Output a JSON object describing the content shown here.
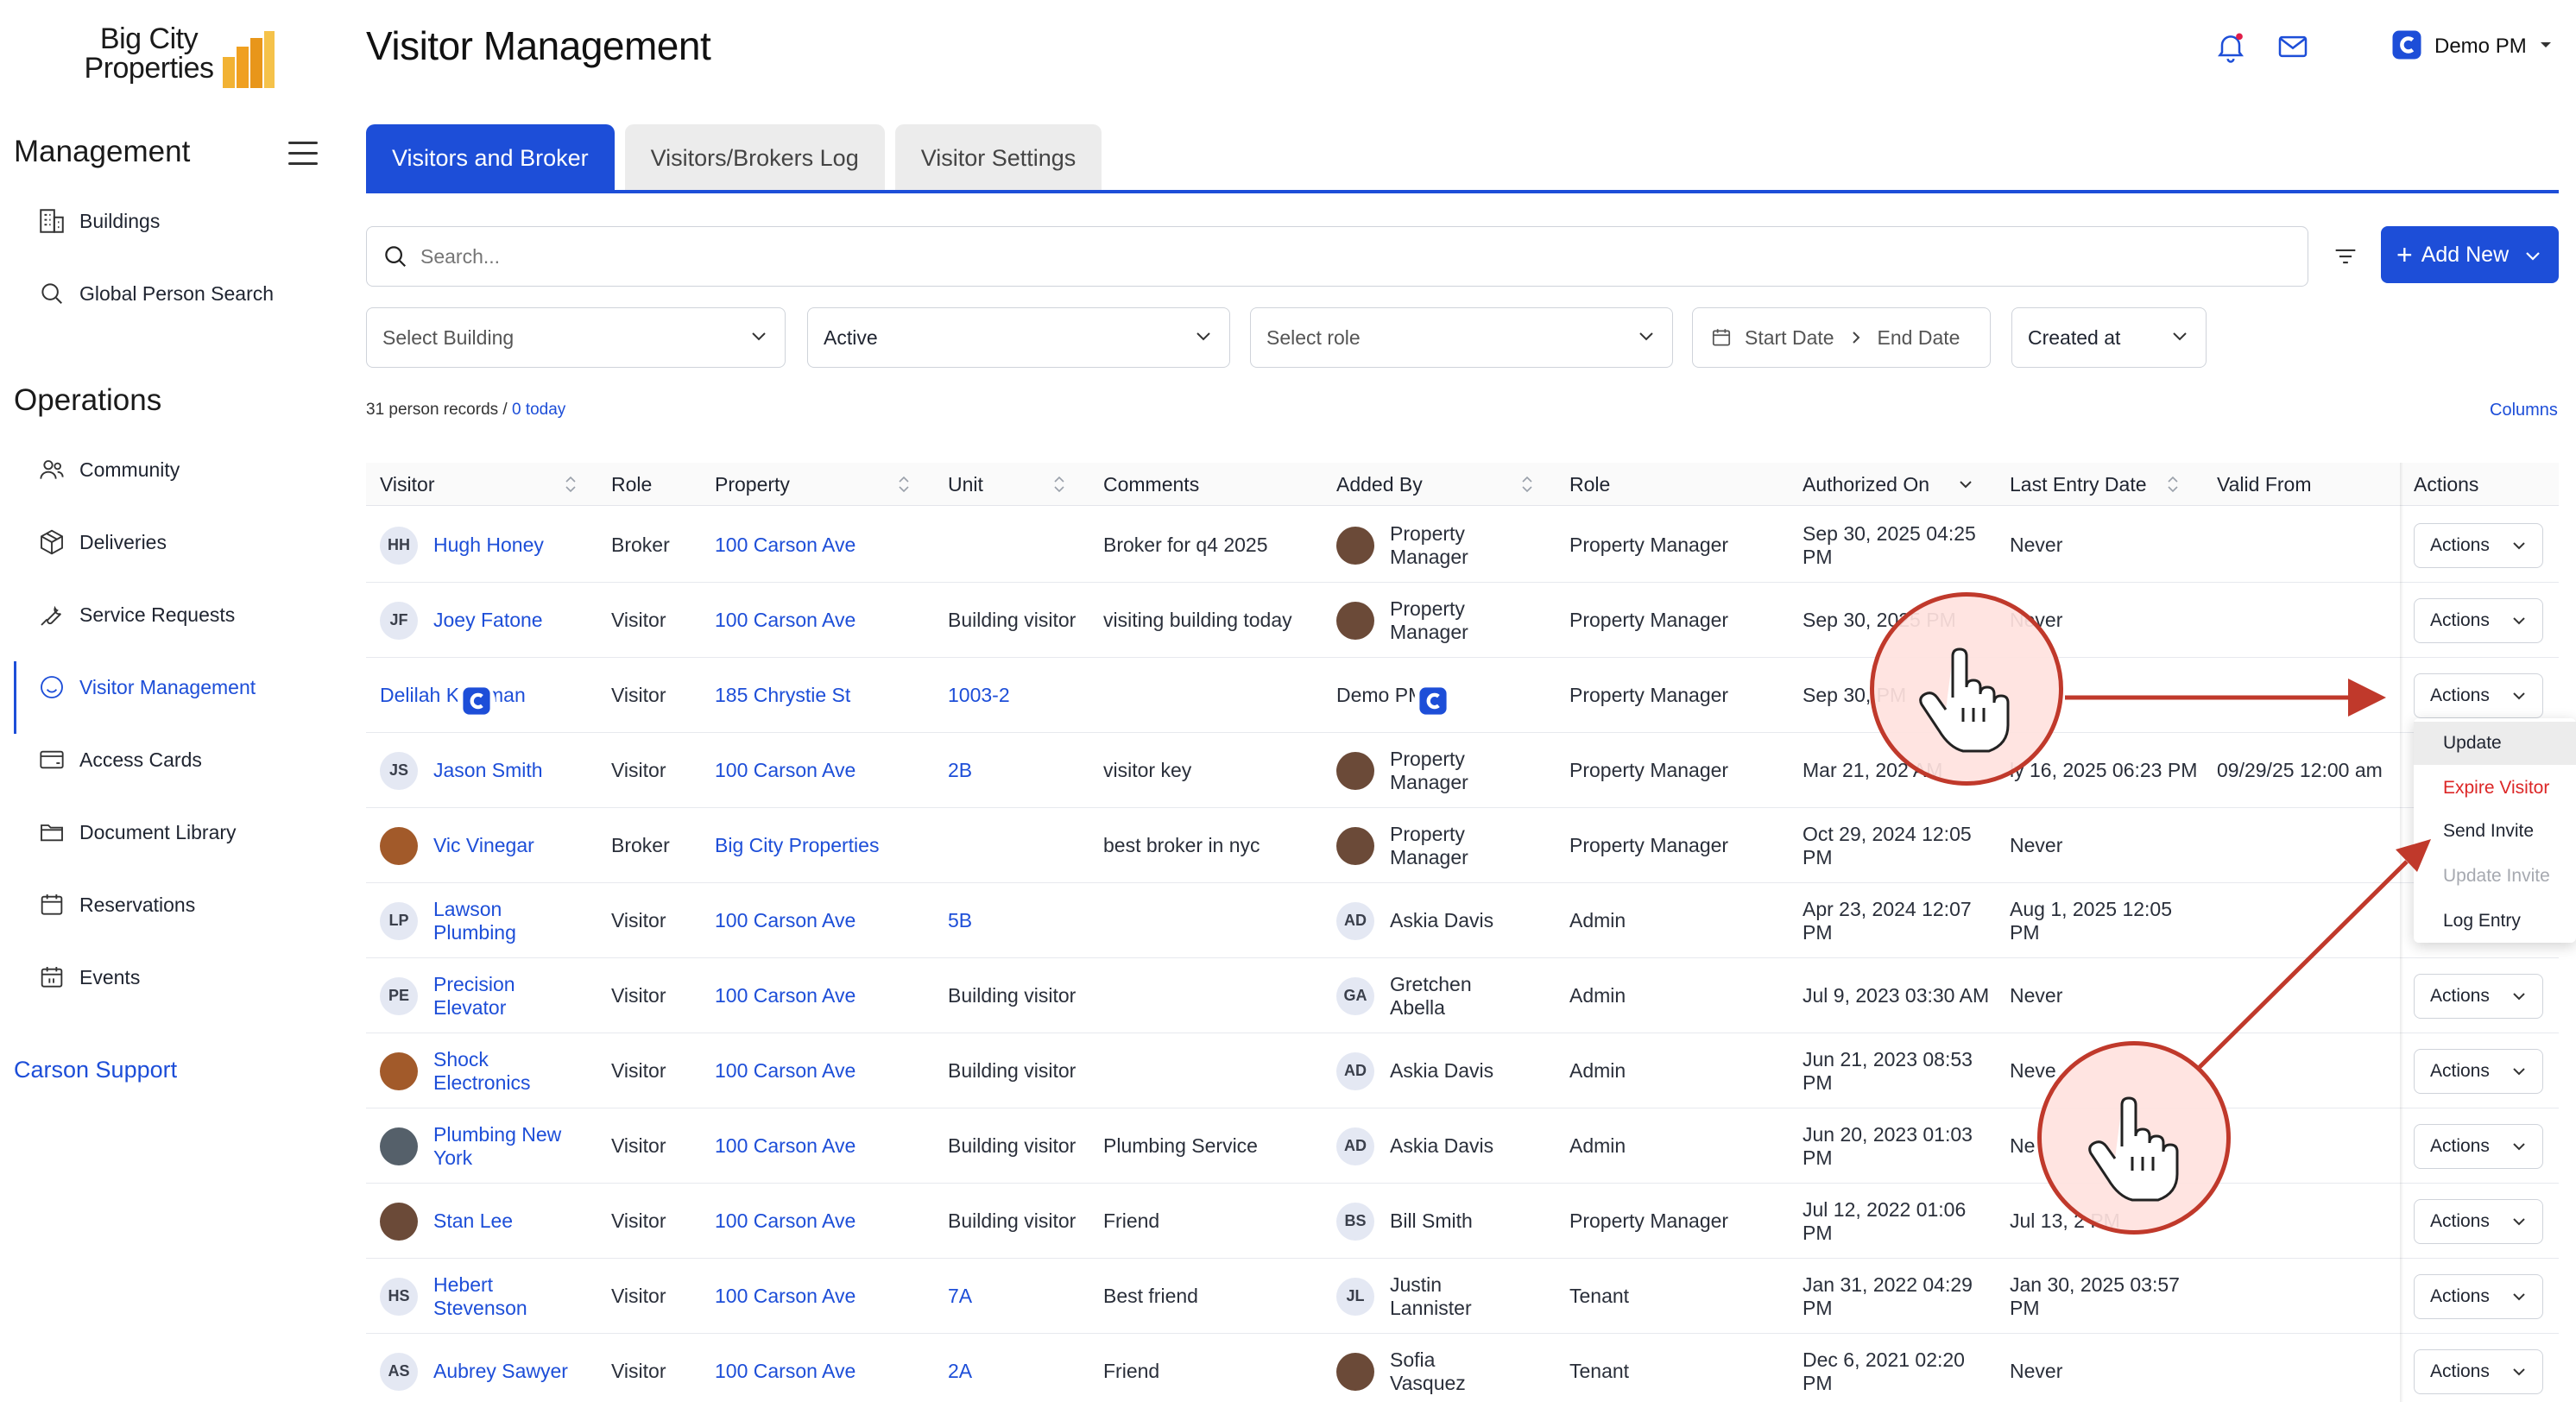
{
  "brand": {
    "logo_line1": "Big City",
    "logo_line2": "Properties"
  },
  "sidebar": {
    "management_title": "Management",
    "management_items": [
      {
        "label": "Buildings",
        "icon": "building-icon"
      },
      {
        "label": "Global Person Search",
        "icon": "search-icon"
      }
    ],
    "operations_title": "Operations",
    "operations_items": [
      {
        "label": "Community",
        "icon": "people-icon"
      },
      {
        "label": "Deliveries",
        "icon": "package-icon"
      },
      {
        "label": "Service Requests",
        "icon": "wrench-icon"
      },
      {
        "label": "Visitor Management",
        "icon": "smiley-icon",
        "active": true
      },
      {
        "label": "Access Cards",
        "icon": "card-icon"
      },
      {
        "label": "Document Library",
        "icon": "folder-icon"
      },
      {
        "label": "Reservations",
        "icon": "calendar-icon"
      },
      {
        "label": "Events",
        "icon": "calendar-day-icon"
      }
    ],
    "support_label": "Carson Support"
  },
  "header": {
    "title": "Visitor Management",
    "user_name": "Demo PM"
  },
  "tabs": [
    {
      "label": "Visitors and Broker",
      "active": true
    },
    {
      "label": "Visitors/Brokers Log",
      "active": false
    },
    {
      "label": "Visitor Settings",
      "active": false
    }
  ],
  "search": {
    "placeholder": "Search..."
  },
  "add_new_label": "Add New",
  "filters": {
    "building": "Select Building",
    "status": "Active",
    "role": "Select role",
    "start_date": "Start Date",
    "end_date": "End Date",
    "sort": "Created at"
  },
  "records": {
    "count_text": "31 person records / ",
    "today_text": "0 today"
  },
  "columns_link": "Columns",
  "table": {
    "headers": {
      "visitor": "Visitor",
      "role": "Role",
      "property": "Property",
      "unit": "Unit",
      "comments": "Comments",
      "added_by": "Added By",
      "added_role": "Role",
      "authorized_on": "Authorized On",
      "last_entry": "Last Entry Date",
      "valid_from": "Valid From",
      "actions": "Actions"
    },
    "rows": [
      {
        "initials": "HH",
        "name": "Hugh Honey",
        "role": "Broker",
        "property": "100 Carson Ave",
        "unit": "",
        "comments": "Broker for q4 2025",
        "added_by": "Property Manager",
        "added_by_avatar": "photo",
        "added_role": "Property Manager",
        "authorized": "Sep 30, 2025 04:25 PM",
        "last_entry": "Never",
        "valid_from": "",
        "actions": "Actions"
      },
      {
        "initials": "JF",
        "name": "Joey Fatone",
        "role": "Visitor",
        "property": "100 Carson Ave",
        "unit": "Building visitor",
        "unit_link": false,
        "comments": "visiting building today",
        "added_by": "Property Manager",
        "added_by_avatar": "photo",
        "added_role": "Property Manager",
        "authorized": "Sep 30, 2025 PM",
        "last_entry": "Never",
        "valid_from": "",
        "actions": "Actions"
      },
      {
        "initials": "",
        "name": "Delilah Kaufman",
        "role": "Visitor",
        "property": "185 Chrystie St",
        "unit": "1003-2",
        "unit_link": true,
        "comments": "",
        "added_by": "Demo PM",
        "added_by_avatar": "logo",
        "added_role": "Property Manager",
        "authorized": "Sep 30, PM",
        "last_entry": "",
        "valid_from": "",
        "actions": "Actions"
      },
      {
        "initials": "JS",
        "name": "Jason Smith",
        "role": "Visitor",
        "property": "100 Carson Ave",
        "unit": "2B",
        "unit_link": true,
        "comments": "visitor key",
        "added_by": "Property Manager",
        "added_by_avatar": "photo",
        "added_role": "Property Manager",
        "authorized": "Mar 21, 202 AM",
        "last_entry": "ly 16, 2025 06:23 PM",
        "valid_from": "09/29/25 12:00 am",
        "actions": ""
      },
      {
        "initials": "",
        "name": "Vic Vinegar",
        "role": "Broker",
        "property": "Big City Properties",
        "unit": "",
        "comments": "best broker in nyc",
        "added_by": "Property Manager",
        "added_by_avatar": "photo",
        "added_role": "Property Manager",
        "authorized": "Oct 29, 2024 12:05 PM",
        "last_entry": "Never",
        "valid_from": "",
        "actions": ""
      },
      {
        "initials": "LP",
        "name": "Lawson Plumbing",
        "role": "Visitor",
        "property": "100 Carson Ave",
        "unit": "5B",
        "unit_link": true,
        "comments": "",
        "added_by": "Askia Davis",
        "added_by_initials": "AD",
        "added_role": "Admin",
        "authorized": "Apr 23, 2024 12:07 PM",
        "last_entry": "Aug 1, 2025 12:05 PM",
        "valid_from": "",
        "actions": ""
      },
      {
        "initials": "PE",
        "name": "Precision Elevator",
        "role": "Visitor",
        "property": "100 Carson Ave",
        "unit": "Building visitor",
        "unit_link": false,
        "comments": "",
        "added_by": "Gretchen Abella",
        "added_by_initials": "GA",
        "added_role": "Admin",
        "authorized": "Jul 9, 2023 03:30 AM",
        "last_entry": "Never",
        "valid_from": "",
        "actions": "Actions"
      },
      {
        "initials": "",
        "name": "Shock Electronics",
        "role": "Visitor",
        "property": "100 Carson Ave",
        "unit": "Building visitor",
        "unit_link": false,
        "comments": "",
        "added_by": "Askia Davis",
        "added_by_initials": "AD",
        "added_role": "Admin",
        "authorized": "Jun 21, 2023 08:53 PM",
        "last_entry": "Neve",
        "valid_from": "",
        "actions": "Actions"
      },
      {
        "initials": "",
        "name": "Plumbing New York",
        "role": "Visitor",
        "property": "100 Carson Ave",
        "unit": "Building visitor",
        "unit_link": false,
        "comments": "Plumbing Service",
        "added_by": "Askia Davis",
        "added_by_initials": "AD",
        "added_role": "Admin",
        "authorized": "Jun 20, 2023 01:03 PM",
        "last_entry": "Ne",
        "valid_from": "",
        "actions": "Actions"
      },
      {
        "initials": "",
        "name": "Stan Lee",
        "role": "Visitor",
        "property": "100 Carson Ave",
        "unit": "Building visitor",
        "unit_link": false,
        "comments": "Friend",
        "added_by": "Bill Smith",
        "added_by_initials": "BS",
        "added_role": "Property Manager",
        "authorized": "Jul 12, 2022 01:06 PM",
        "last_entry": "Jul 13, 2 PM",
        "valid_from": "",
        "actions": "Actions"
      },
      {
        "initials": "HS",
        "name": "Hebert Stevenson",
        "role": "Visitor",
        "property": "100 Carson Ave",
        "unit": "7A",
        "unit_link": true,
        "comments": "Best friend",
        "added_by": "Justin Lannister",
        "added_by_initials": "JL",
        "added_role": "Tenant",
        "authorized": "Jan 31, 2022 04:29 PM",
        "last_entry": "Jan 30, 2025 03:57 PM",
        "valid_from": "",
        "actions": "Actions"
      },
      {
        "initials": "AS",
        "name": "Aubrey Sawyer",
        "role": "Visitor",
        "property": "100 Carson Ave",
        "unit": "2A",
        "unit_link": true,
        "comments": "Friend",
        "added_by": "Sofia Vasquez",
        "added_by_avatar": "photo",
        "added_role": "Tenant",
        "authorized": "Dec 6, 2021 02:20 PM",
        "last_entry": "Never",
        "valid_from": "",
        "actions": "Actions"
      }
    ]
  },
  "actions_menu": [
    {
      "label": "Update",
      "state": "highlighted"
    },
    {
      "label": "Expire Visitor",
      "state": "danger"
    },
    {
      "label": "Send Invite",
      "state": "normal"
    },
    {
      "label": "Update Invite",
      "state": "disabled"
    },
    {
      "label": "Log Entry",
      "state": "normal"
    }
  ],
  "colors": {
    "accent": "#1d4ed8",
    "danger": "#dc2626",
    "annotation": "#c0392b"
  }
}
